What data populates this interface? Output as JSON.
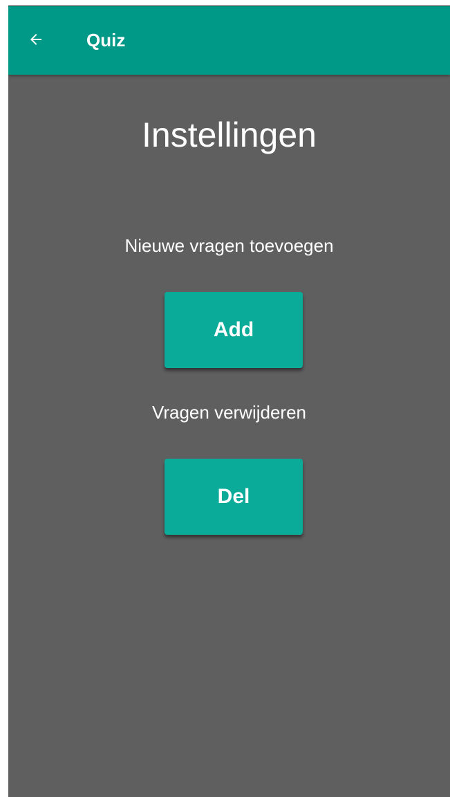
{
  "appbar": {
    "back_icon": "arrow-left-icon",
    "title": "Quiz",
    "color": "#009887"
  },
  "main": {
    "title": "Instellingen",
    "add_section_label": "Nieuwe vragen toevoegen",
    "add_button_label": "Add",
    "delete_section_label": "Vragen verwijderen",
    "delete_button_label": "Del",
    "background_color": "#5f5f5f",
    "button_color": "#0aab99"
  }
}
